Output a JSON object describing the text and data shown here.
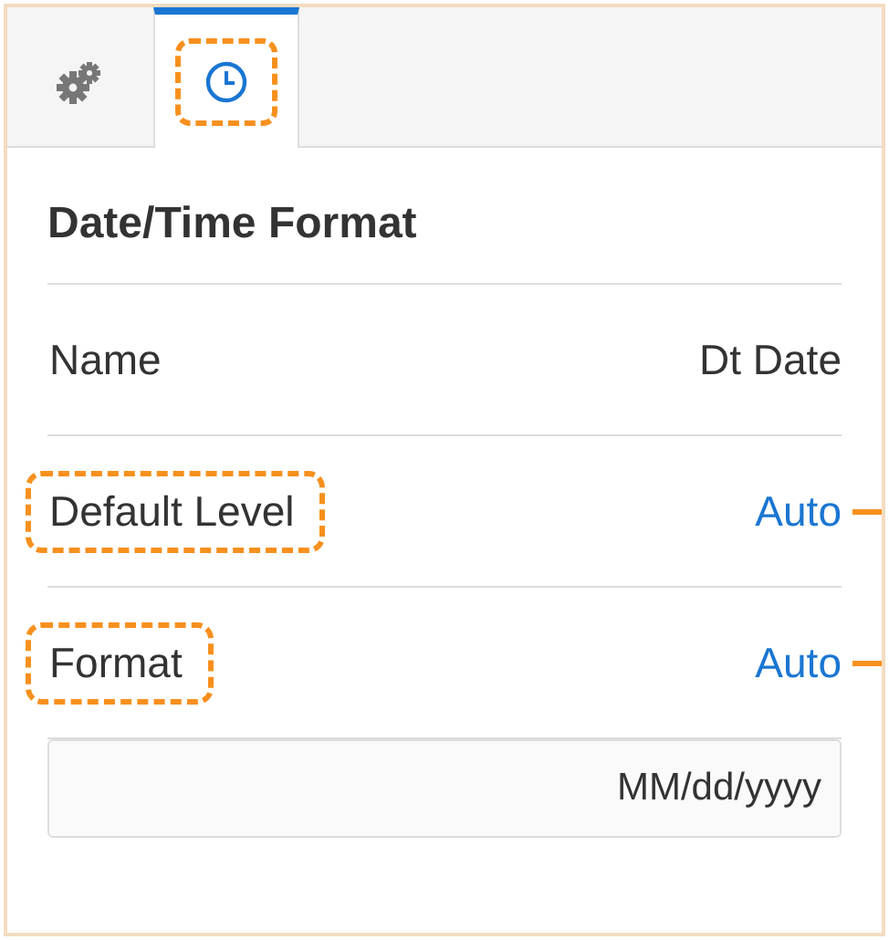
{
  "tabs": [
    {
      "kind": "gears",
      "selected": false,
      "highlighted": false
    },
    {
      "kind": "clock",
      "selected": true,
      "highlighted": true
    }
  ],
  "panel": {
    "title": "Date/Time Format",
    "rows": [
      {
        "label": "Name",
        "value": "Dt Date",
        "kind": "text",
        "highlighted": false,
        "callout": false
      },
      {
        "label": "Default Level",
        "value": "Auto",
        "kind": "link",
        "highlighted": true,
        "callout": true
      },
      {
        "label": "Format",
        "value": "Auto",
        "kind": "link",
        "highlighted": true,
        "callout": true
      }
    ],
    "format_field": {
      "value": "MM/dd/yyyy"
    }
  }
}
